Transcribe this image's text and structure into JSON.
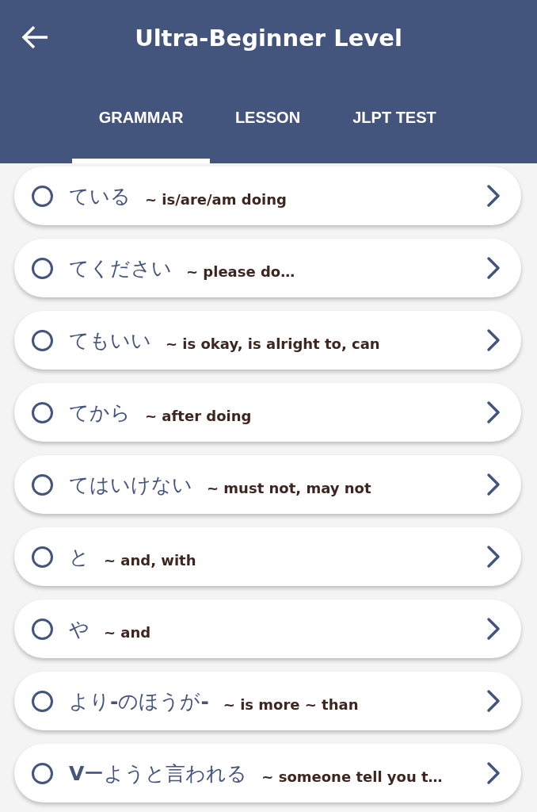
{
  "app_bar": {
    "title": "Ultra-Beginner Level"
  },
  "tabs": [
    {
      "label": "GRAMMAR",
      "selected": true
    },
    {
      "label": "LESSON",
      "selected": false
    },
    {
      "label": "JLPT TEST",
      "selected": false
    }
  ],
  "items": [
    {
      "pattern": "ている",
      "meaning": "~ is/are/am doing",
      "completed": false
    },
    {
      "pattern": "てください",
      "meaning": "~ please do…",
      "completed": false
    },
    {
      "pattern": "てもいい",
      "meaning": "~ is okay, is alright to, can",
      "completed": false
    },
    {
      "pattern": "てから",
      "meaning": "~ after doing",
      "completed": false
    },
    {
      "pattern": "てはいけない",
      "meaning": "~ must not, may not",
      "completed": false
    },
    {
      "pattern": "と",
      "meaning": "~ and, with",
      "completed": false
    },
    {
      "pattern": "や",
      "meaning": "~ and",
      "completed": false
    },
    {
      "pattern": "より**-**のほうが**-**",
      "meaning": "~ is more ~ than",
      "completed": false
    },
    {
      "pattern": "**V**ーようと言われる",
      "meaning": "~ someone tell you t…",
      "completed": false
    }
  ]
}
